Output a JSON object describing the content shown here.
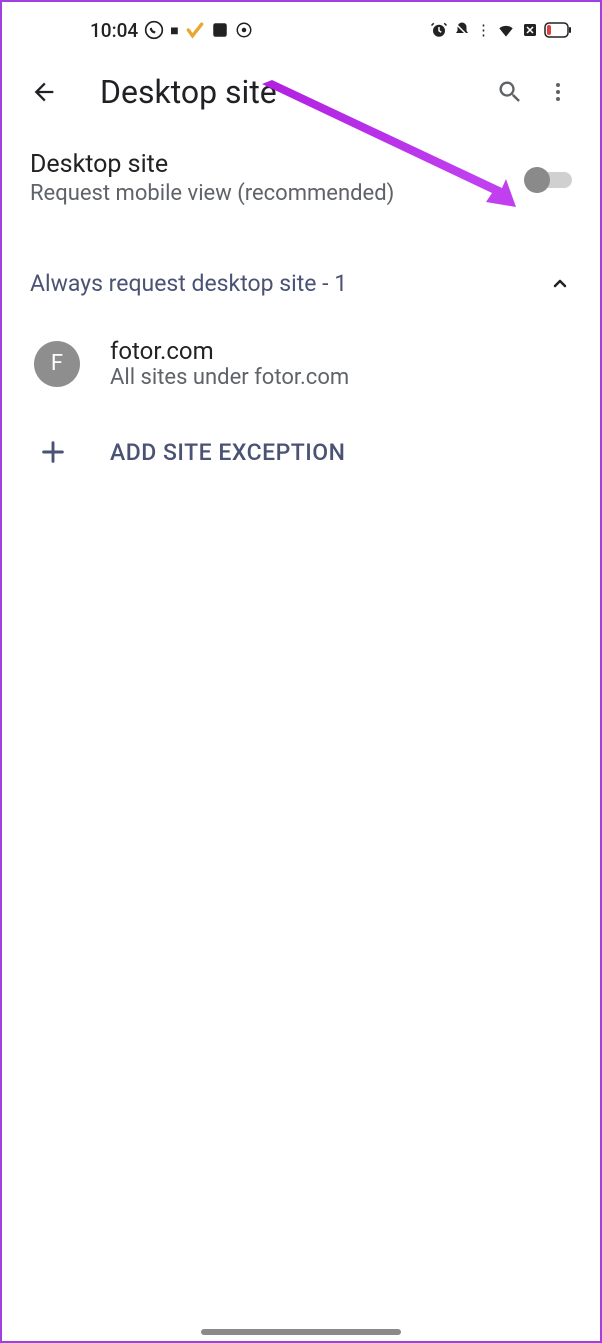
{
  "status": {
    "time": "10:04"
  },
  "appbar": {
    "title": "Desktop site"
  },
  "setting": {
    "title": "Desktop site",
    "subtitle": "Request mobile view (recommended)",
    "enabled": false
  },
  "section": {
    "title": "Always request desktop site - 1",
    "expanded": true
  },
  "sites": [
    {
      "initial": "F",
      "domain": "fotor.com",
      "desc": "All sites under fotor.com"
    }
  ],
  "add": {
    "label": "ADD SITE EXCEPTION"
  }
}
